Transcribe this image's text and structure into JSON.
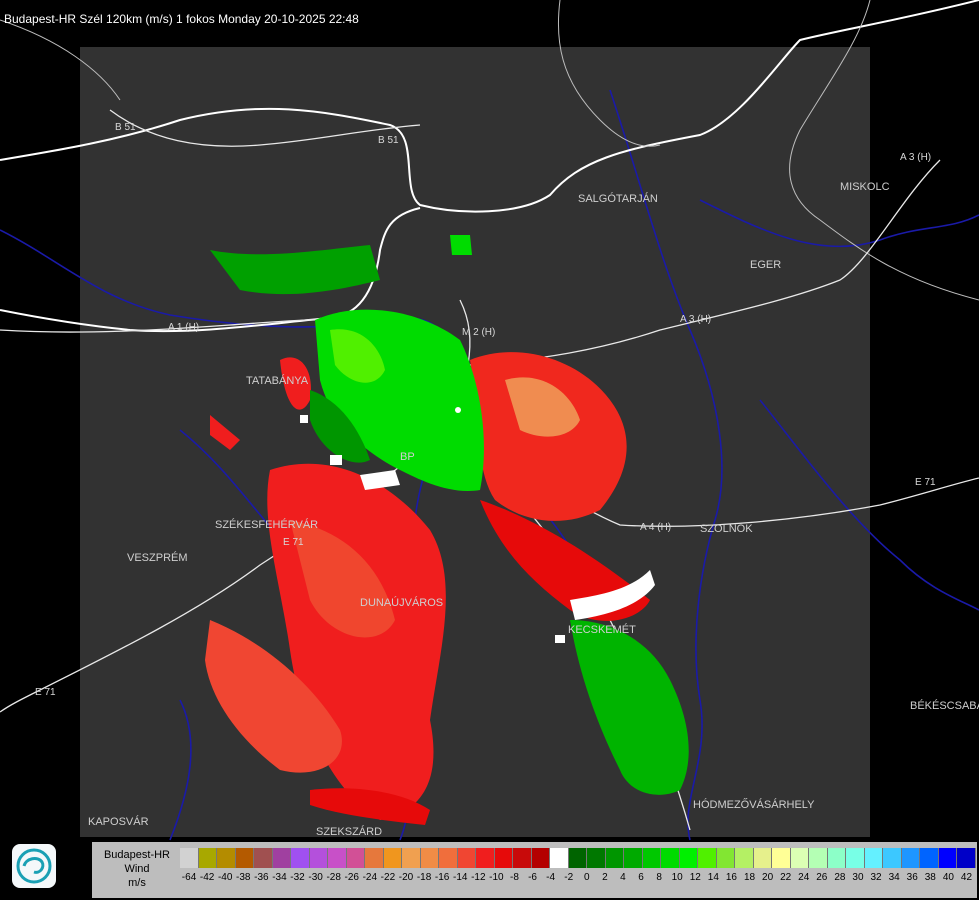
{
  "title": "Budapest-HR Szél 120km (m/s) 1 fokos Monday 20-10-2025 22:48",
  "colors": {
    "background": "#000000",
    "panel": "#323232",
    "border_line": "#ffffff",
    "river": "#1a1aa8"
  },
  "map": {
    "cities": [
      "SALGÓTARJÁN",
      "EGER",
      "MISKOLC",
      "TATABÁNYA",
      "SZÉKESFEHÉRVÁR",
      "VESZPRÉM",
      "DUNAÚJVÁROS",
      "SZOLNOK",
      "KECSKEMÉT",
      "BÉKÉSCSABA",
      "HÓDMEZŐVÁSÁRHELY",
      "KAPOSVÁR",
      "SZEKSZÁRD",
      "BP"
    ],
    "roads": [
      "B 51",
      "B 51",
      "A 1 (H)",
      "A 3 (H)",
      "A 3 (H)",
      "A 4 (H)",
      "E 71",
      "E 71",
      "E 71",
      "M 2 (H)"
    ]
  },
  "legend": {
    "label_lines": [
      "Budapest-HR",
      "Wind",
      "m/s"
    ],
    "colors": [
      "#d2d2d2",
      "#a8a800",
      "#b48c00",
      "#b45a00",
      "#a05050",
      "#a040a0",
      "#a050f0",
      "#b450dc",
      "#c850c8",
      "#d25096",
      "#e6783c",
      "#f0961e",
      "#f0a050",
      "#f08c46",
      "#f06e3c",
      "#f04632",
      "#f01e1e",
      "#e60a0a",
      "#c80a0a",
      "#b40000",
      "#ffffff",
      "#006400",
      "#007800",
      "#009600",
      "#00aa00",
      "#00c800",
      "#00dc00",
      "#00f000",
      "#50f000",
      "#82e632",
      "#b4f064",
      "#e6f08c",
      "#ffff96",
      "#dcffb4",
      "#b4ffb4",
      "#8cffc8",
      "#78ffe6",
      "#64f0ff",
      "#3cc8ff",
      "#1e96ff",
      "#0064ff",
      "#0000ff",
      "#0000c8"
    ],
    "ticks": [
      "-64",
      "-42",
      "-40",
      "-38",
      "-36",
      "-34",
      "-32",
      "-30",
      "-28",
      "-26",
      "-24",
      "-22",
      "-20",
      "-18",
      "-16",
      "-14",
      "-12",
      "-10",
      "-8",
      "-6",
      "-4",
      "-2",
      "0",
      "2",
      "4",
      "6",
      "8",
      "10",
      "12",
      "14",
      "16",
      "18",
      "20",
      "22",
      "24",
      "26",
      "28",
      "30",
      "32",
      "34",
      "36",
      "38",
      "40",
      "42"
    ]
  },
  "logo_icon": "swirl-logo-icon"
}
